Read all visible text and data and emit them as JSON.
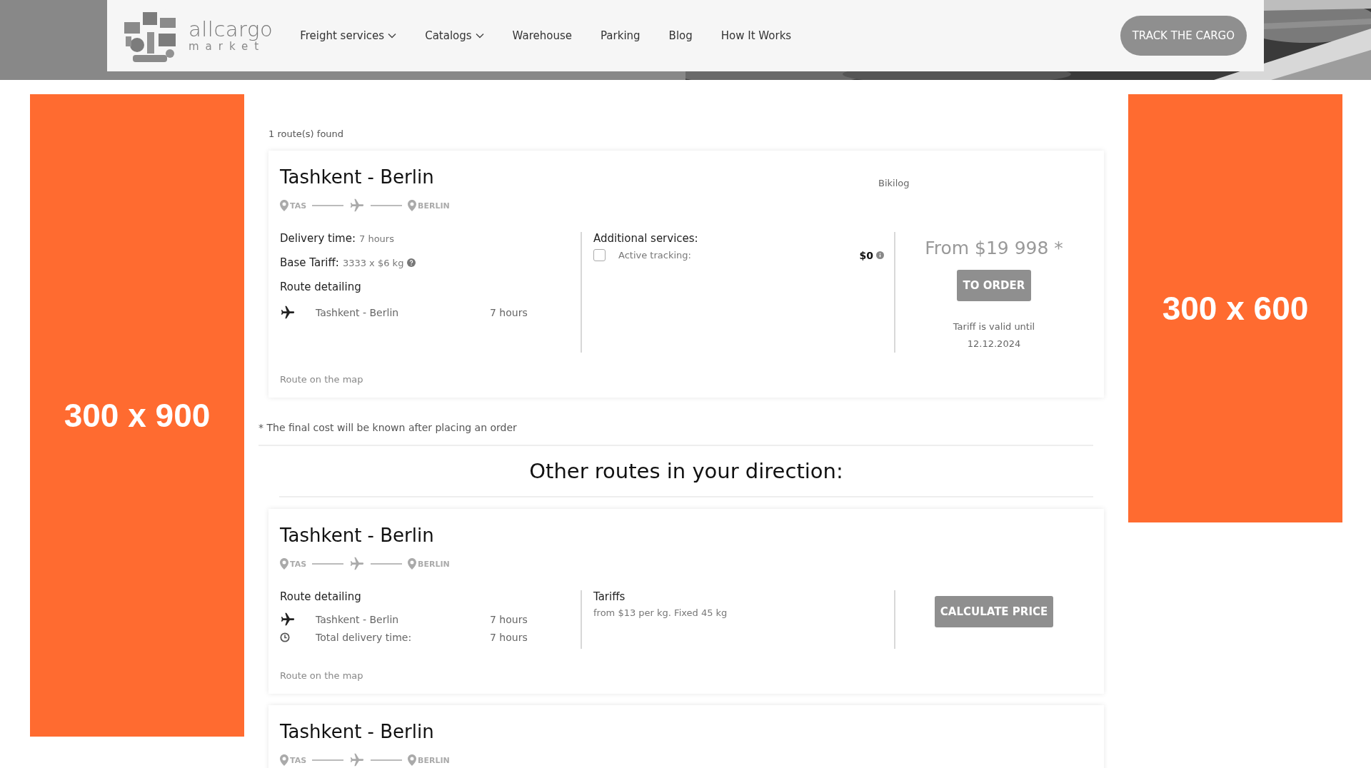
{
  "header": {
    "logo": {
      "name": "allcargo",
      "tagline": "market"
    },
    "nav": [
      {
        "label": "Freight services",
        "dropdown": true
      },
      {
        "label": "Catalogs",
        "dropdown": true
      },
      {
        "label": "Warehouse",
        "dropdown": false
      },
      {
        "label": "Parking",
        "dropdown": false
      },
      {
        "label": "Blog",
        "dropdown": false
      },
      {
        "label": "How It Works",
        "dropdown": false
      }
    ],
    "action_button": "TRACK THE CARGO"
  },
  "ads": {
    "left_banner": "300 x 900",
    "right_banner": "300 x 600"
  },
  "results": {
    "count_text": "1 route(s) found",
    "routes": [
      {
        "title": "Tashkent - Berlin",
        "from_code": "TAS",
        "to_code": "BERLIN",
        "carrier": "Bikilog",
        "delivery": {
          "label": "Delivery time:",
          "value": "7 hours"
        },
        "base_tariff": {
          "label": "Base Tariff:",
          "value": "3333 x $6 kg"
        },
        "detailing_heading": "Route detailing",
        "legs": [
          {
            "kind": "flight",
            "name": "Tashkent - Berlin",
            "duration": "7 hours"
          }
        ],
        "services_heading": "Additional services:",
        "services": [
          {
            "label": "Active tracking:",
            "price": "$0",
            "checked": false
          }
        ],
        "price": "From $19 998 *",
        "button": "TO ORDER",
        "valid_text": "Tariff is valid until",
        "valid_date": "12.12.2024",
        "map_link": "Route on the map"
      }
    ],
    "footnote": "*  The final cost will be known after placing an order",
    "other_heading": "Other routes in your direction:",
    "other_routes": [
      {
        "title": "Tashkent - Berlin",
        "from_code": "TAS",
        "to_code": "BERLIN",
        "detailing_heading": "Route detailing",
        "legs": [
          {
            "kind": "flight",
            "name": "Tashkent - Berlin",
            "duration": "7 hours"
          },
          {
            "kind": "total",
            "name": "Total delivery time:",
            "duration": "7 hours"
          }
        ],
        "tariffs_heading": "Tariffs",
        "tariffs_text": "from $13 per kg. Fixed 45 kg",
        "button": "CALCULATE PRICE",
        "map_link": "Route on the map"
      },
      {
        "title": "Tashkent - Berlin",
        "from_code": "TAS",
        "to_code": "BERLIN"
      }
    ]
  }
}
